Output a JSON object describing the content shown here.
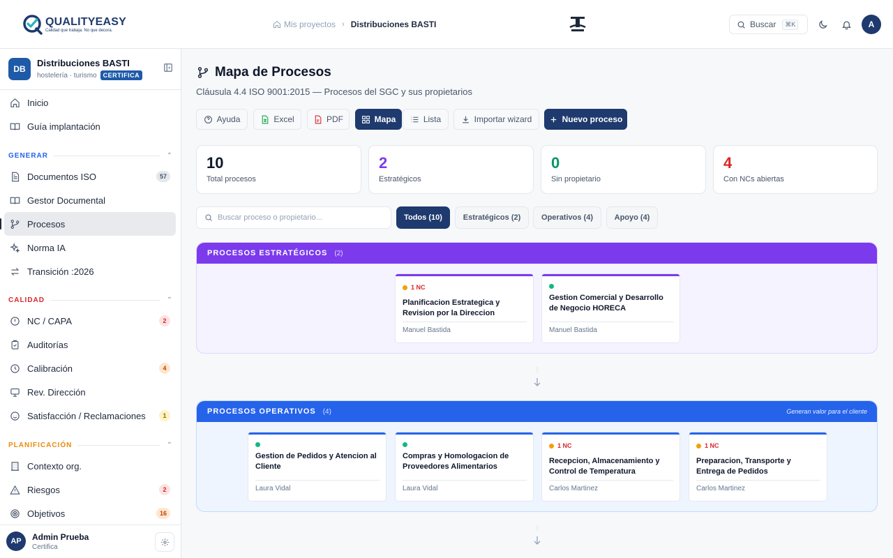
{
  "brand": {
    "name": "QUALITYEASY",
    "tagline": "Calidad que trabaja. No que decora."
  },
  "breadcrumb": {
    "parent": "Mis proyectos",
    "current": "Distribuciones BASTI"
  },
  "topbar": {
    "search_label": "Buscar",
    "search_shortcut": "⌘K",
    "user_initial": "A"
  },
  "org": {
    "initials": "DB",
    "name": "Distribuciones BASTI",
    "sector": "hostelería · turismo",
    "badge": "CERTIFICA"
  },
  "nav": {
    "top": [
      {
        "label": "Inicio"
      },
      {
        "label": "Guía implantación"
      }
    ],
    "generar": {
      "title": "GENERAR",
      "items": [
        {
          "label": "Documentos ISO",
          "count": "57"
        },
        {
          "label": "Gestor Documental"
        },
        {
          "label": "Procesos"
        },
        {
          "label": "Norma IA"
        },
        {
          "label": "Transición :2026"
        }
      ]
    },
    "calidad": {
      "title": "CALIDAD",
      "items": [
        {
          "label": "NC / CAPA",
          "count": "2"
        },
        {
          "label": "Auditorías"
        },
        {
          "label": "Calibración",
          "count": "4"
        },
        {
          "label": "Rev. Dirección"
        },
        {
          "label": "Satisfacción / Reclamaciones",
          "count": "1"
        }
      ]
    },
    "planificacion": {
      "title": "PLANIFICACIÓN",
      "items": [
        {
          "label": "Contexto org."
        },
        {
          "label": "Riesgos",
          "count": "2"
        },
        {
          "label": "Objetivos",
          "count": "16"
        }
      ]
    }
  },
  "user": {
    "initials": "AP",
    "name": "Admin Prueba",
    "role": "Certifica"
  },
  "page": {
    "title": "Mapa de Procesos",
    "subtitle": "Cláusula 4.4 ISO 9001:2015 — Procesos del SGC y sus propietarios"
  },
  "toolbar": {
    "help": "Ayuda",
    "excel": "Excel",
    "pdf": "PDF",
    "map": "Mapa",
    "list": "Lista",
    "import": "Importar wizard",
    "new": "Nuevo proceso"
  },
  "stats": [
    {
      "value": "10",
      "label": "Total procesos",
      "color": "#0f172a"
    },
    {
      "value": "2",
      "label": "Estratégicos",
      "color": "#7c3aed"
    },
    {
      "value": "0",
      "label": "Sin propietario",
      "color": "#059669"
    },
    {
      "value": "4",
      "label": "Con NCs abiertas",
      "color": "#dc2626"
    }
  ],
  "filters": {
    "search_placeholder": "Buscar proceso o propietario...",
    "chips": [
      "Todos (10)",
      "Estratégicos (2)",
      "Operativos (4)",
      "Apoyo (4)"
    ]
  },
  "groups": {
    "strategic": {
      "title": "PROCESOS ESTRATÉGICOS",
      "count": "(2)",
      "color": "#7c3aed",
      "processes": [
        {
          "status": "1 NC",
          "title": "Planificacion Estrategica y Revision por la Direccion",
          "owner": "Manuel Bastida"
        },
        {
          "status": "",
          "title": "Gestion Comercial y Desarrollo de Negocio HORECA",
          "owner": "Manuel Bastida"
        }
      ]
    },
    "operational": {
      "title": "PROCESOS OPERATIVOS",
      "count": "(4)",
      "note": "Generan valor para el cliente",
      "color": "#2563eb",
      "processes": [
        {
          "status": "",
          "title": "Gestion de Pedidos y Atencion al Cliente",
          "owner": "Laura Vidal"
        },
        {
          "status": "",
          "title": "Compras y Homologacion de Proveedores Alimentarios",
          "owner": "Laura Vidal"
        },
        {
          "status": "1 NC",
          "title": "Recepcion, Almacenamiento y Control de Temperatura",
          "owner": "Carlos Martinez"
        },
        {
          "status": "1 NC",
          "title": "Preparacion, Transporte y Entrega de Pedidos",
          "owner": "Carlos Martinez"
        }
      ]
    }
  }
}
